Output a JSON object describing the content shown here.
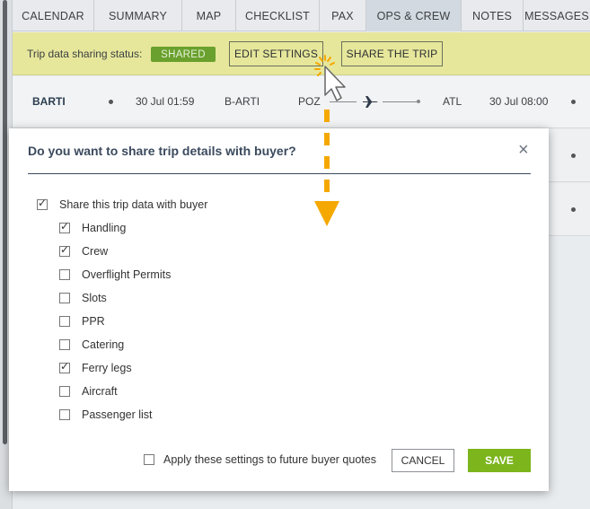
{
  "tabs": [
    {
      "label": "CALENDAR"
    },
    {
      "label": "SUMMARY"
    },
    {
      "label": "MAP"
    },
    {
      "label": "CHECKLIST"
    },
    {
      "label": "PAX"
    },
    {
      "label": "OPS & CREW"
    },
    {
      "label": "NOTES"
    },
    {
      "label": "MESSAGES"
    }
  ],
  "active_tab": "OPS & CREW",
  "share_bar": {
    "label": "Trip data sharing status:",
    "status": "SHARED",
    "edit_settings": "EDIT SETTINGS",
    "share_trip": "SHARE THE TRIP"
  },
  "trip": {
    "name": "BARTI",
    "departure_time": "30 Jul 01:59",
    "aircraft": "B-ARTI",
    "from": "POZ",
    "to": "ATL",
    "arrival_time": "30 Jul 08:00"
  },
  "modal": {
    "title": "Do you want to share trip details with buyer?",
    "close_symbol": "×",
    "master_option": {
      "label": "Share this trip data with buyer",
      "checked": true
    },
    "options": [
      {
        "label": "Handling",
        "checked": true
      },
      {
        "label": "Crew",
        "checked": true
      },
      {
        "label": "Overflight Permits",
        "checked": false
      },
      {
        "label": "Slots",
        "checked": false
      },
      {
        "label": "PPR",
        "checked": false
      },
      {
        "label": "Catering",
        "checked": false
      },
      {
        "label": "Ferry legs",
        "checked": true
      },
      {
        "label": "Aircraft",
        "checked": false
      },
      {
        "label": "Passenger list",
        "checked": false
      }
    ],
    "future_option": {
      "label": "Apply these settings to future buyer quotes",
      "checked": false
    },
    "cancel": "CANCEL",
    "save": "SAVE"
  },
  "colors": {
    "share_bar_bg": "#e6e79b",
    "badge_green": "#6aa02d",
    "save_green": "#7cb51c",
    "title_navy": "#3b4a5e",
    "annotation_orange": "#f5a800"
  }
}
